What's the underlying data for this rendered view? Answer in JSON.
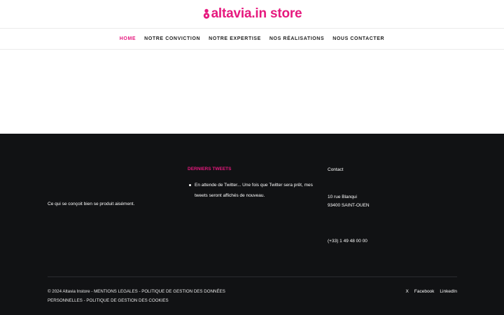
{
  "brand": {
    "logo_text": "altavia.in store",
    "accent_color": "#e6197e"
  },
  "nav": {
    "items": [
      {
        "label": "HOME",
        "active": true
      },
      {
        "label": "NOTRE CONVICTION",
        "active": false
      },
      {
        "label": "NOTRE EXPERTISE",
        "active": false
      },
      {
        "label": "NOS RÉALISATIONS",
        "active": false
      },
      {
        "label": "NOUS CONTACTER",
        "active": false
      }
    ]
  },
  "footer": {
    "tagline": "Ce qui se conçoit bien se produit aisément.",
    "tweets": {
      "title": "DERNIERS TWEETS",
      "items": [
        "En attende de Twitter... Une fois que Twitter sera prêt, mes tweets seront affichés de nouveau."
      ]
    },
    "contact": {
      "title": "Contact",
      "address_line1": "10 rue Blanqui",
      "address_line2": "93400 SAINT-OUEN",
      "phone": "(+33) 1 49 48 00 00"
    },
    "copyright": {
      "prefix": "© 2024 Altavia Instore - ",
      "legal": "MENTIONS LEGALES",
      "sep1": " - ",
      "privacy": "POLITIQUE DE GESTION DES DONNÉES PERSONNELLES",
      "sep2": " - ",
      "cookies": "POLITIQUE DE GESTION DES COOKIES"
    },
    "social": [
      {
        "label": "X",
        "icon": "x-icon"
      },
      {
        "label": "Facebook",
        "icon": "facebook-icon"
      },
      {
        "label": "LinkedIn",
        "icon": "linkedin-icon"
      }
    ],
    "background_color": "#111214"
  }
}
